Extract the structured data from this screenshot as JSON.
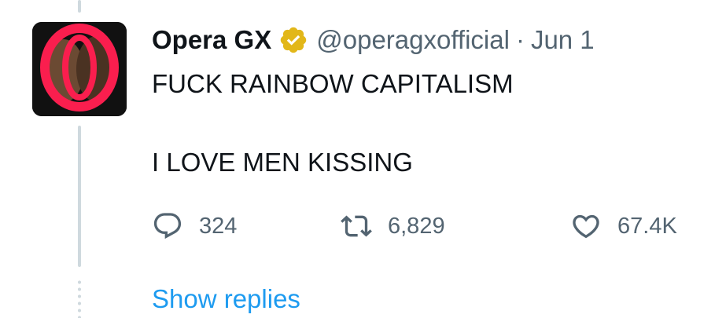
{
  "tweet": {
    "author": {
      "display_name": "Opera GX",
      "handle": "@operagxofficial",
      "verified_icon": "gold-verified-badge-icon",
      "avatar_icon": "opera-gx-logo-avatar"
    },
    "separator": "·",
    "date": "Jun 1",
    "text_lines": [
      "FUCK RAINBOW CAPITALISM",
      "I LOVE MEN KISSING"
    ],
    "actions": {
      "reply": {
        "icon": "reply-bubble-icon",
        "count": "324"
      },
      "retweet": {
        "icon": "retweet-icon",
        "count": "6,829"
      },
      "like": {
        "icon": "heart-icon",
        "count": "67.4K"
      }
    },
    "show_replies_label": "Show replies"
  },
  "colors": {
    "text": "#0f1419",
    "secondary_text": "#536471",
    "link": "#1d9bf0",
    "verified_gold": "#e2b719",
    "thread_line": "#cfd9de",
    "logo_ring": "#fa1e4e"
  }
}
